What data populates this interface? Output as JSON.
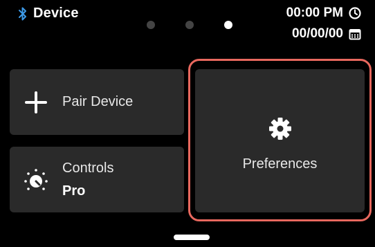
{
  "status_bar": {
    "title": "Device",
    "time": "00:00 PM",
    "date": "00/00/00",
    "icons": {
      "left": "bluetooth-icon",
      "time": "clock-icon",
      "date": "calendar-icon"
    }
  },
  "pager": {
    "total": 3,
    "active_index": 2
  },
  "tiles": {
    "pair": {
      "label": "Pair Device",
      "icon": "plus-icon"
    },
    "controls": {
      "label": "Controls",
      "sublabel": "Pro",
      "icon": "controls-dial-icon"
    },
    "preferences": {
      "label": "Preferences",
      "icon": "gear-icon",
      "selected": true
    }
  },
  "colors": {
    "background": "#000000",
    "tile": "#2a2a2a",
    "selection_outline": "#e8685e",
    "bluetooth": "#3d9be9",
    "dot_inactive": "#444444",
    "dot_active": "#ffffff"
  }
}
